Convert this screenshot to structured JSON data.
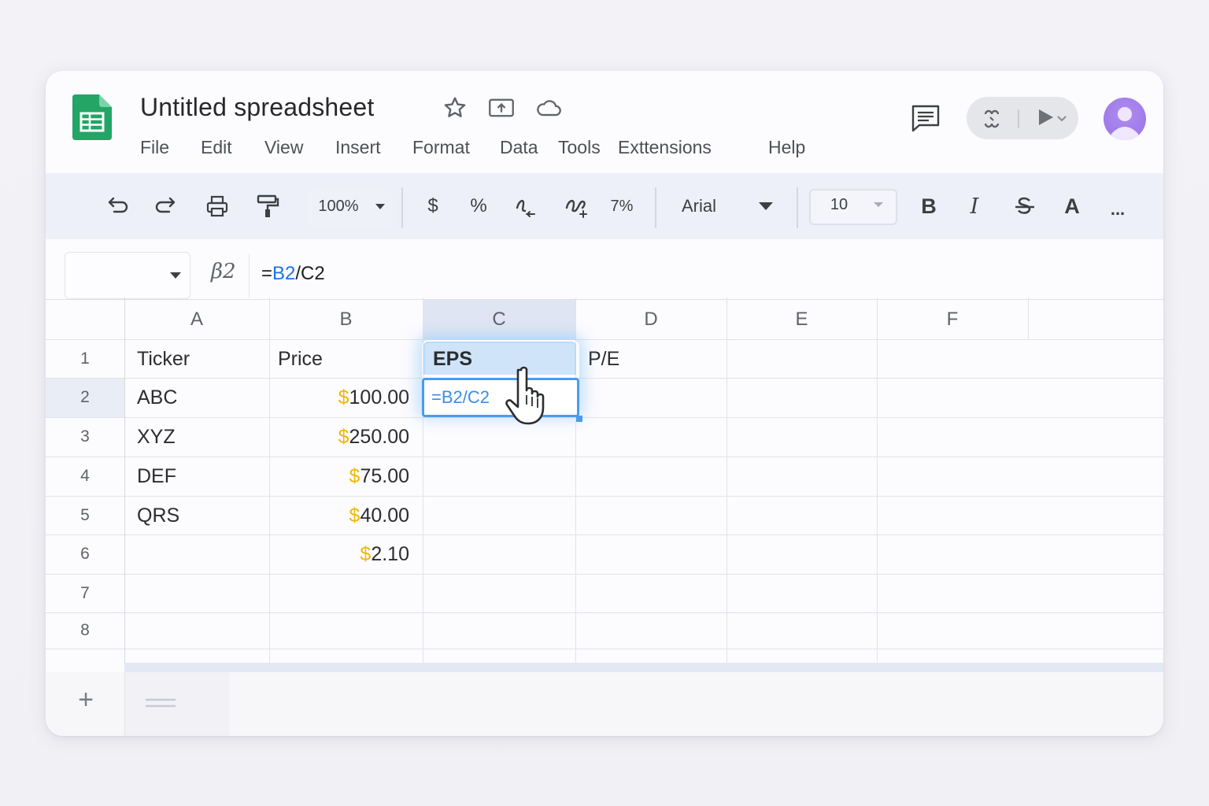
{
  "app": {
    "title": "Untitled spreadsheet",
    "icons": [
      "sheets-logo-icon",
      "star-icon",
      "move-to-drive-icon",
      "cloud-status-icon",
      "comment-icon",
      "meet-icon",
      "present-icon",
      "avatar-icon"
    ]
  },
  "menu": {
    "items": [
      "File",
      "Edit",
      "View",
      "Insert",
      "Format",
      "Data",
      "Tools",
      "Exttensions",
      "Help"
    ]
  },
  "toolbar": {
    "zoom": "100%",
    "currency": "$",
    "percent": "%",
    "percent_format": "7%",
    "font": "Arial",
    "font_size": "10",
    "bold": "B",
    "italic": "I",
    "text_color": "A",
    "more": "..."
  },
  "formula_bar": {
    "name_box": "",
    "fx_label": "β2",
    "formula_prefix": "=",
    "formula_ref1": "B2",
    "formula_sep": "/",
    "formula_ref2": "C2"
  },
  "sheet": {
    "columns": [
      "A",
      "B",
      "C",
      "D",
      "E",
      "F"
    ],
    "rows": [
      "1",
      "2",
      "3",
      "4",
      "5",
      "6",
      "7",
      "8"
    ],
    "cells": {
      "A1": "Ticker",
      "B1": "Price",
      "C1": "EPS",
      "D1": "P/E",
      "A2": "ABC",
      "A3": "XYZ",
      "A4": "DEF",
      "A5": "QRS",
      "B2": "100.00",
      "B3": "250.00",
      "B4": "75.00",
      "B5": "40.00",
      "B6": "2.10",
      "C2_editing": "=B2/C2"
    },
    "currency_symbol": "$"
  },
  "bottom": {
    "add_sheet": "+"
  },
  "colors": {
    "sheets_green": "#23a566",
    "selection_blue": "#4a9bed",
    "currency_gold": "#f2b705",
    "toolbar_bg": "#edf0f8"
  }
}
